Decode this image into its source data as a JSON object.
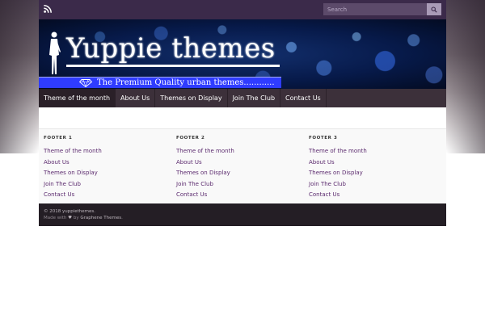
{
  "topbar": {
    "search_placeholder": "Search"
  },
  "header": {
    "site_title": "Yuppie themes",
    "tagline": "The Premium Quality urban themes............"
  },
  "nav": {
    "items": [
      {
        "label": "Theme of the month"
      },
      {
        "label": "About Us"
      },
      {
        "label": "Themes on Display"
      },
      {
        "label": "Join The Club"
      },
      {
        "label": "Contact Us"
      }
    ]
  },
  "footer": {
    "columns": [
      {
        "heading": "FOOTER 1",
        "links": [
          "Theme of the month",
          "About Us",
          "Themes on Display",
          "Join The Club",
          "Contact Us"
        ]
      },
      {
        "heading": "FOOTER 2",
        "links": [
          "Theme of the month",
          "About Us",
          "Themes on Display",
          "Join The Club",
          "Contact Us"
        ]
      },
      {
        "heading": "FOOTER 3",
        "links": [
          "Theme of the month",
          "About Us",
          "Themes on Display",
          "Join The Club",
          "Contact Us"
        ]
      }
    ],
    "copyright": "© 2018 yuppiethemes.",
    "made_with_prefix": "Made with",
    "heart": "♥",
    "by_text": "by",
    "credit_link": "Graphene Themes",
    "credit_suffix": "."
  },
  "colors": {
    "topbar_bg": "#3b2a4a",
    "nav_bg": "#3c303a",
    "link_purple": "#5b2a6e",
    "copyright_bg": "#241e25",
    "tagline_blue": "#2f3cff"
  },
  "icons": {
    "rss": "rss-icon",
    "search": "search-icon",
    "diamond": "diamond-icon",
    "logo_figure": "gentleman-silhouette-icon"
  }
}
